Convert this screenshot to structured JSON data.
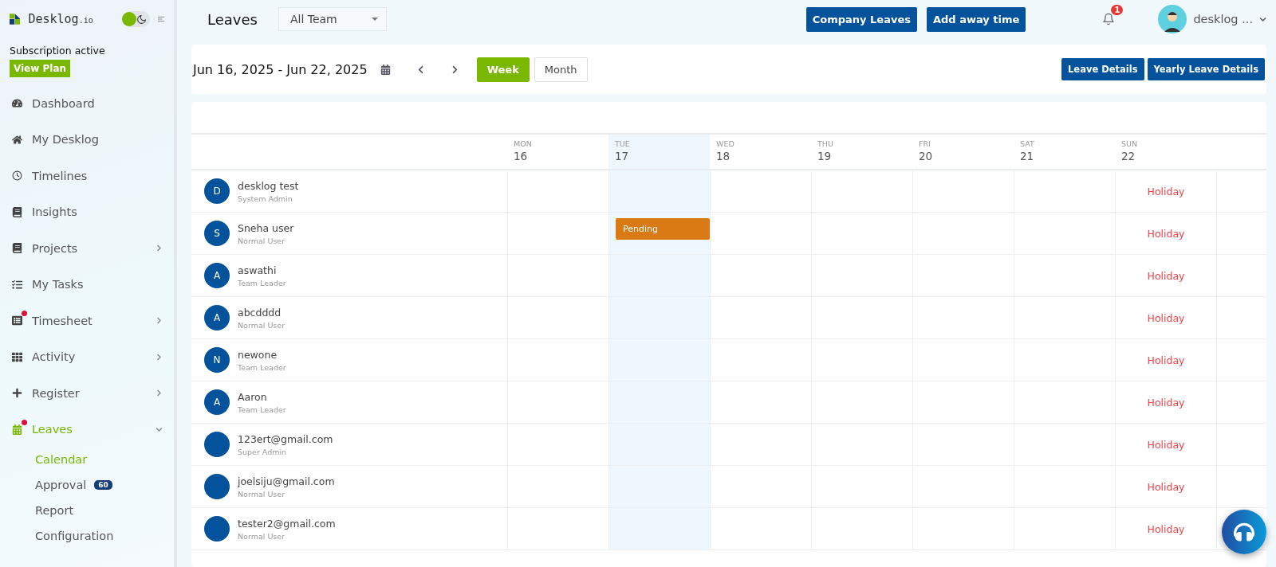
{
  "brand": {
    "name": "Desklog",
    "suffix": ".io"
  },
  "theme_toggle": {
    "dark": false
  },
  "subscription": {
    "status": "Subscription active",
    "button": "View Plan"
  },
  "sidebar": {
    "items": [
      {
        "label": "Dashboard",
        "selected": false,
        "dot": false,
        "has_submenu": false
      },
      {
        "label": "My Desklog",
        "selected": false,
        "dot": false,
        "has_submenu": false
      },
      {
        "label": "Timelines",
        "selected": false,
        "dot": false,
        "has_submenu": false
      },
      {
        "label": "Insights",
        "selected": false,
        "dot": false,
        "has_submenu": false
      },
      {
        "label": "Projects",
        "selected": false,
        "dot": false,
        "has_submenu": true,
        "expanded": false
      },
      {
        "label": "My Tasks",
        "selected": false,
        "dot": false,
        "has_submenu": false
      },
      {
        "label": "Timesheet",
        "selected": false,
        "dot": true,
        "has_submenu": true,
        "expanded": false
      },
      {
        "label": "Activity",
        "selected": false,
        "dot": false,
        "has_submenu": true,
        "expanded": false
      },
      {
        "label": "Register",
        "selected": false,
        "dot": false,
        "has_submenu": true,
        "expanded": false
      },
      {
        "label": "Leaves",
        "selected": true,
        "dot": true,
        "has_submenu": true,
        "expanded": true,
        "children": [
          {
            "label": "Calendar",
            "selected": true
          },
          {
            "label": "Approval",
            "selected": false,
            "badge": "60"
          },
          {
            "label": "Report",
            "selected": false
          },
          {
            "label": "Configuration",
            "selected": false
          }
        ]
      }
    ]
  },
  "header": {
    "title": "Leaves",
    "team_select": "All Team",
    "buttons": [
      "Company Leaves",
      "Add away time"
    ],
    "notifications": "1",
    "user": "desklog ..."
  },
  "toolbar": {
    "range": "Jun 16, 2025 - Jun 22, 2025",
    "views": [
      {
        "label": "Week",
        "selected": true
      },
      {
        "label": "Month",
        "selected": false
      }
    ],
    "buttons": [
      "Leave Details",
      "Yearly Leave Details"
    ]
  },
  "calendar": {
    "days": [
      {
        "dow": "MON",
        "date": "16",
        "selected": false
      },
      {
        "dow": "TUE",
        "date": "17",
        "selected": true
      },
      {
        "dow": "WED",
        "date": "18",
        "selected": false
      },
      {
        "dow": "THU",
        "date": "19",
        "selected": false
      },
      {
        "dow": "FRI",
        "date": "20",
        "selected": false
      },
      {
        "dow": "SAT",
        "date": "21",
        "selected": false
      },
      {
        "dow": "SUN",
        "date": "22",
        "selected": false
      }
    ],
    "rows": [
      {
        "name": "desklog test",
        "role": "System Admin",
        "initial": "D",
        "cells": [
          {
            "kind": "empty"
          },
          {
            "kind": "empty"
          },
          {
            "kind": "empty"
          },
          {
            "kind": "empty"
          },
          {
            "kind": "empty"
          },
          {
            "kind": "empty"
          },
          {
            "kind": "holiday",
            "text": "Holiday"
          }
        ]
      },
      {
        "name": "Sneha user",
        "role": "Normal User",
        "initial": "S",
        "cells": [
          {
            "kind": "empty"
          },
          {
            "kind": "pending",
            "text": "Pending"
          },
          {
            "kind": "empty"
          },
          {
            "kind": "empty"
          },
          {
            "kind": "empty"
          },
          {
            "kind": "empty"
          },
          {
            "kind": "holiday",
            "text": "Holiday"
          }
        ]
      },
      {
        "name": "aswathi",
        "role": "Team Leader",
        "initial": "A",
        "cells": [
          {
            "kind": "empty"
          },
          {
            "kind": "empty"
          },
          {
            "kind": "empty"
          },
          {
            "kind": "empty"
          },
          {
            "kind": "empty"
          },
          {
            "kind": "empty"
          },
          {
            "kind": "holiday",
            "text": "Holiday"
          }
        ]
      },
      {
        "name": "abcdddd",
        "role": "Normal User",
        "initial": "A",
        "cells": [
          {
            "kind": "empty"
          },
          {
            "kind": "empty"
          },
          {
            "kind": "empty"
          },
          {
            "kind": "empty"
          },
          {
            "kind": "empty"
          },
          {
            "kind": "empty"
          },
          {
            "kind": "holiday",
            "text": "Holiday"
          }
        ]
      },
      {
        "name": "newone",
        "role": "Team Leader",
        "initial": "N",
        "cells": [
          {
            "kind": "empty"
          },
          {
            "kind": "empty"
          },
          {
            "kind": "empty"
          },
          {
            "kind": "empty"
          },
          {
            "kind": "empty"
          },
          {
            "kind": "empty"
          },
          {
            "kind": "holiday",
            "text": "Holiday"
          }
        ]
      },
      {
        "name": "Aaron",
        "role": "Team Leader",
        "initial": "A",
        "cells": [
          {
            "kind": "empty"
          },
          {
            "kind": "empty"
          },
          {
            "kind": "empty"
          },
          {
            "kind": "empty"
          },
          {
            "kind": "empty"
          },
          {
            "kind": "empty"
          },
          {
            "kind": "holiday",
            "text": "Holiday"
          }
        ]
      },
      {
        "name": "123ert@gmail.com",
        "role": "Super Admin",
        "cells": [
          {
            "kind": "empty"
          },
          {
            "kind": "empty"
          },
          {
            "kind": "empty"
          },
          {
            "kind": "empty"
          },
          {
            "kind": "empty"
          },
          {
            "kind": "empty"
          },
          {
            "kind": "holiday",
            "text": "Holiday"
          }
        ]
      },
      {
        "name": "joelsiju@gmail.com",
        "role": "Normal User",
        "cells": [
          {
            "kind": "empty"
          },
          {
            "kind": "empty"
          },
          {
            "kind": "empty"
          },
          {
            "kind": "empty"
          },
          {
            "kind": "empty"
          },
          {
            "kind": "empty"
          },
          {
            "kind": "holiday",
            "text": "Holiday"
          }
        ]
      },
      {
        "name": "tester2@gmail.com",
        "role": "Normal User",
        "cells": [
          {
            "kind": "empty"
          },
          {
            "kind": "empty"
          },
          {
            "kind": "empty"
          },
          {
            "kind": "empty"
          },
          {
            "kind": "empty"
          },
          {
            "kind": "empty"
          },
          {
            "kind": "holiday",
            "text": "Holiday"
          }
        ]
      }
    ]
  }
}
